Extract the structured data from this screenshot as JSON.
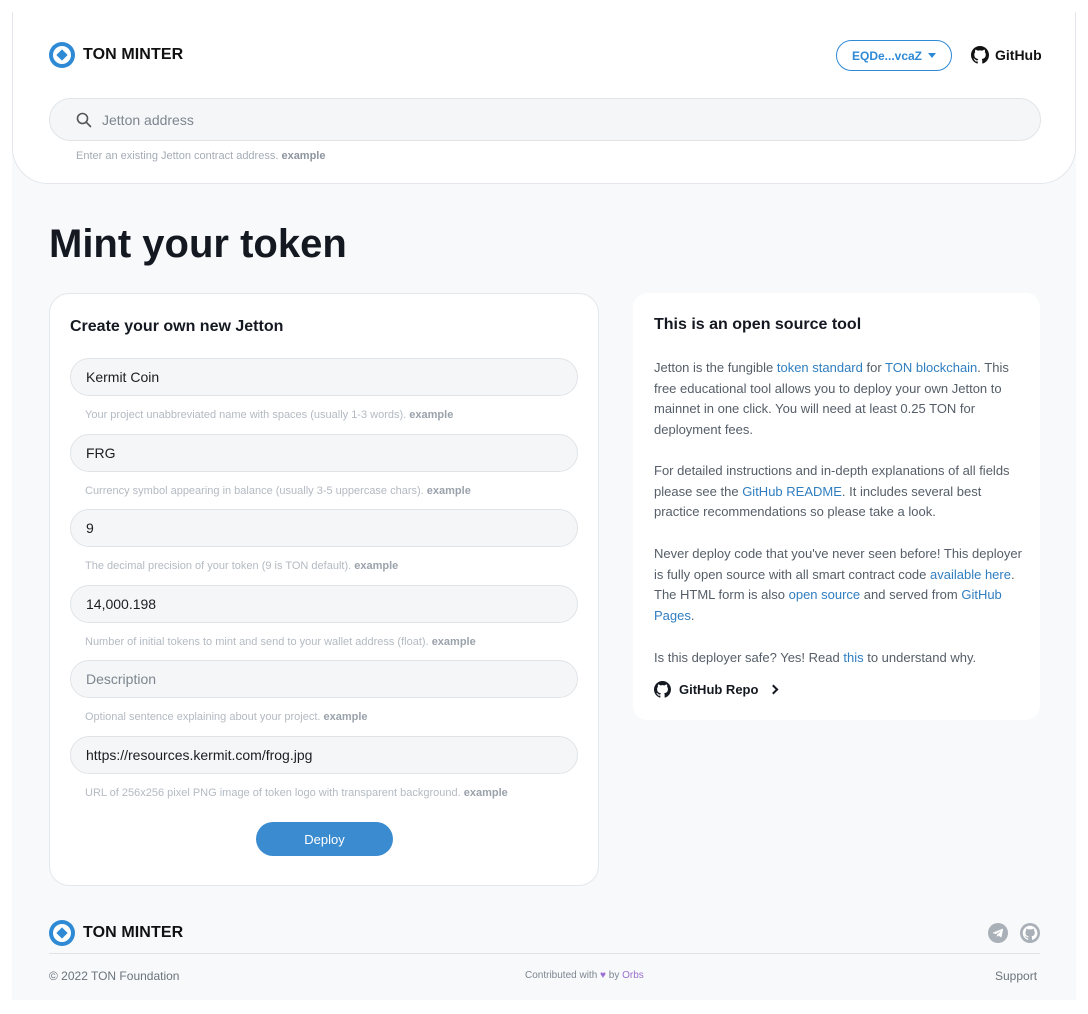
{
  "header": {
    "logo_text": "TON MINTER",
    "wallet_address": "EQDe...vcaZ",
    "github_label": "GitHub",
    "search": {
      "placeholder": "Jetton address",
      "hint_prefix": "Enter an existing Jetton contract address.",
      "hint_link": "example"
    }
  },
  "page_title": "Mint your token",
  "form": {
    "title": "Create your own new Jetton",
    "fields": [
      {
        "value": "Kermit Coin",
        "placeholder": "",
        "hint": "Your project unabbreviated name with spaces (usually 1-3 words).",
        "hint_link": "example"
      },
      {
        "value": "FRG",
        "placeholder": "",
        "hint": "Currency symbol appearing in balance (usually 3-5 uppercase chars).",
        "hint_link": "example"
      },
      {
        "value": "9",
        "placeholder": "",
        "hint": "The decimal precision of your token (9 is TON default).",
        "hint_link": "example"
      },
      {
        "value": "14,000.198",
        "placeholder": "",
        "hint": "Number of initial tokens to mint and send to your wallet address (float).",
        "hint_link": "example"
      },
      {
        "value": "",
        "placeholder": "Description",
        "hint": "Optional sentence explaining about your project.",
        "hint_link": "example"
      },
      {
        "value": "https://resources.kermit.com/frog.jpg",
        "placeholder": "",
        "hint": "URL of 256x256 pixel PNG image of token logo with transparent background.",
        "hint_link": "example"
      }
    ],
    "deploy_label": "Deploy"
  },
  "info": {
    "title": "This is an open source tool",
    "p1": {
      "t1": "Jetton is the fungible ",
      "l1": "token standard",
      "t2": " for ",
      "l2": "TON blockchain",
      "t3": ". This free educational tool allows you to deploy your own Jetton to mainnet in one click. You will need at least 0.25 TON for deployment fees."
    },
    "p2": {
      "t1": "For detailed instructions and in-depth explanations of all fields please see the ",
      "l1": "GitHub README",
      "t2": ". It includes several best practice recommendations so please take a look."
    },
    "p3": {
      "t1": "Never deploy code that you've never seen before! This deployer is fully open source with all smart contract code ",
      "l1": "available here",
      "t2": ". The HTML form is also ",
      "l2": "open source",
      "t3": " and served from ",
      "l3": "GitHub Pages",
      "t4": "."
    },
    "p4": {
      "t1": "Is this deployer safe? Yes! Read ",
      "l1": "this",
      "t2": " to understand why."
    },
    "repo_label": "GitHub Repo"
  },
  "footer": {
    "logo_text": "TON MINTER",
    "copyright": "© 2022 TON Foundation",
    "contrib_prefix": "Contributed with",
    "heart": "♥",
    "contrib_by": "by",
    "contrib_link": "Orbs",
    "support": "Support",
    "icons": [
      "telegram-icon",
      "github-icon"
    ]
  },
  "colors": {
    "accent": "#2f8ad6",
    "button": "#3a8bcf",
    "link": "#2f7ec0",
    "title": "#141820",
    "orbs": "#9b6fd0"
  }
}
